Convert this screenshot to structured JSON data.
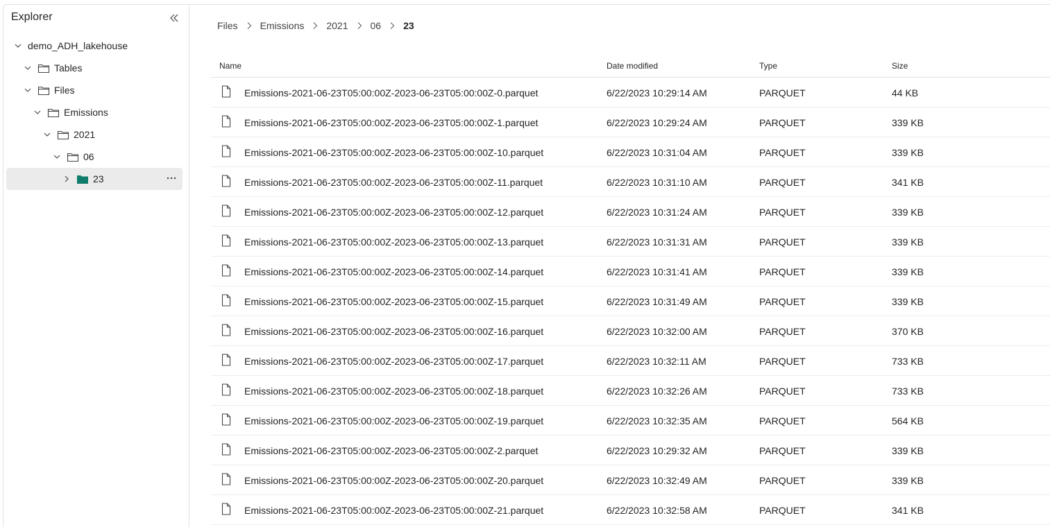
{
  "sidebar": {
    "title": "Explorer",
    "collapse_icon": "double-chevron-left-icon",
    "tree": [
      {
        "label": "demo_ADH_lakehouse",
        "level": 0,
        "expanded": true,
        "folder": false
      },
      {
        "label": "Tables",
        "level": 1,
        "expanded": true,
        "folder": true
      },
      {
        "label": "Files",
        "level": 1,
        "expanded": true,
        "folder": true
      },
      {
        "label": "Emissions",
        "level": 2,
        "expanded": true,
        "folder": true
      },
      {
        "label": "2021",
        "level": 3,
        "expanded": true,
        "folder": true
      },
      {
        "label": "06",
        "level": 4,
        "expanded": true,
        "folder": true
      },
      {
        "label": "23",
        "level": 5,
        "expanded": false,
        "folder": true,
        "selected": true
      }
    ],
    "more_icon": "more-horizontal-icon"
  },
  "breadcrumb": [
    "Files",
    "Emissions",
    "2021",
    "06",
    "23"
  ],
  "table": {
    "headers": {
      "name": "Name",
      "date": "Date modified",
      "type": "Type",
      "size": "Size"
    },
    "rows": [
      {
        "name": "Emissions-2021-06-23T05:00:00Z-2023-06-23T05:00:00Z-0.parquet",
        "date": "6/22/2023 10:29:14 AM",
        "type": "PARQUET",
        "size": "44 KB"
      },
      {
        "name": "Emissions-2021-06-23T05:00:00Z-2023-06-23T05:00:00Z-1.parquet",
        "date": "6/22/2023 10:29:24 AM",
        "type": "PARQUET",
        "size": "339 KB"
      },
      {
        "name": "Emissions-2021-06-23T05:00:00Z-2023-06-23T05:00:00Z-10.parquet",
        "date": "6/22/2023 10:31:04 AM",
        "type": "PARQUET",
        "size": "339 KB"
      },
      {
        "name": "Emissions-2021-06-23T05:00:00Z-2023-06-23T05:00:00Z-11.parquet",
        "date": "6/22/2023 10:31:10 AM",
        "type": "PARQUET",
        "size": "341 KB"
      },
      {
        "name": "Emissions-2021-06-23T05:00:00Z-2023-06-23T05:00:00Z-12.parquet",
        "date": "6/22/2023 10:31:24 AM",
        "type": "PARQUET",
        "size": "339 KB"
      },
      {
        "name": "Emissions-2021-06-23T05:00:00Z-2023-06-23T05:00:00Z-13.parquet",
        "date": "6/22/2023 10:31:31 AM",
        "type": "PARQUET",
        "size": "339 KB"
      },
      {
        "name": "Emissions-2021-06-23T05:00:00Z-2023-06-23T05:00:00Z-14.parquet",
        "date": "6/22/2023 10:31:41 AM",
        "type": "PARQUET",
        "size": "339 KB"
      },
      {
        "name": "Emissions-2021-06-23T05:00:00Z-2023-06-23T05:00:00Z-15.parquet",
        "date": "6/22/2023 10:31:49 AM",
        "type": "PARQUET",
        "size": "339 KB"
      },
      {
        "name": "Emissions-2021-06-23T05:00:00Z-2023-06-23T05:00:00Z-16.parquet",
        "date": "6/22/2023 10:32:00 AM",
        "type": "PARQUET",
        "size": "370 KB"
      },
      {
        "name": "Emissions-2021-06-23T05:00:00Z-2023-06-23T05:00:00Z-17.parquet",
        "date": "6/22/2023 10:32:11 AM",
        "type": "PARQUET",
        "size": "733 KB"
      },
      {
        "name": "Emissions-2021-06-23T05:00:00Z-2023-06-23T05:00:00Z-18.parquet",
        "date": "6/22/2023 10:32:26 AM",
        "type": "PARQUET",
        "size": "733 KB"
      },
      {
        "name": "Emissions-2021-06-23T05:00:00Z-2023-06-23T05:00:00Z-19.parquet",
        "date": "6/22/2023 10:32:35 AM",
        "type": "PARQUET",
        "size": "564 KB"
      },
      {
        "name": "Emissions-2021-06-23T05:00:00Z-2023-06-23T05:00:00Z-2.parquet",
        "date": "6/22/2023 10:29:32 AM",
        "type": "PARQUET",
        "size": "339 KB"
      },
      {
        "name": "Emissions-2021-06-23T05:00:00Z-2023-06-23T05:00:00Z-20.parquet",
        "date": "6/22/2023 10:32:49 AM",
        "type": "PARQUET",
        "size": "339 KB"
      },
      {
        "name": "Emissions-2021-06-23T05:00:00Z-2023-06-23T05:00:00Z-21.parquet",
        "date": "6/22/2023 10:32:58 AM",
        "type": "PARQUET",
        "size": "341 KB"
      }
    ]
  },
  "colors": {
    "selected_folder": "#107c6b",
    "selected_bg": "#ebebeb",
    "divider": "#e1e1e1"
  }
}
